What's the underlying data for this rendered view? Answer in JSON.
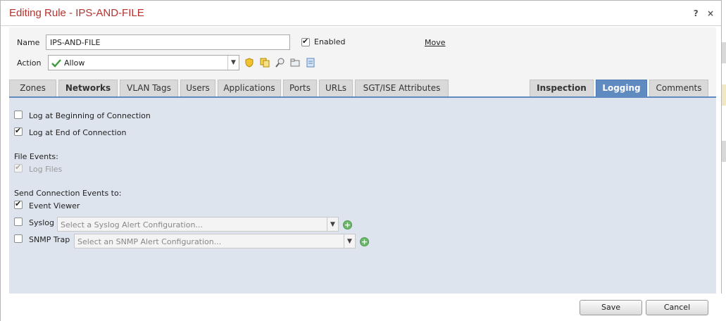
{
  "dialog": {
    "title": "Editing Rule - IPS-AND-FILE",
    "help_icon": "?",
    "close_icon": "×"
  },
  "rule": {
    "name_label": "Name",
    "name_value": "IPS-AND-FILE",
    "enabled_label": "Enabled",
    "enabled_checked": true,
    "move_label": "Move",
    "action_label": "Action",
    "action_value": "Allow",
    "action_icons": [
      "shield-icon",
      "copy-icon",
      "search-icon",
      "folder-icon",
      "note-icon"
    ]
  },
  "tabs": {
    "left": [
      {
        "label": "Zones"
      },
      {
        "label": "Networks"
      },
      {
        "label": "VLAN Tags"
      },
      {
        "label": "Users"
      },
      {
        "label": "Applications"
      },
      {
        "label": "Ports"
      },
      {
        "label": "URLs"
      },
      {
        "label": "SGT/ISE Attributes"
      }
    ],
    "right": [
      {
        "label": "Inspection"
      },
      {
        "label": "Logging"
      },
      {
        "label": "Comments"
      }
    ],
    "active": "Logging"
  },
  "logging": {
    "log_begin": {
      "label": "Log at Beginning of Connection",
      "checked": false
    },
    "log_end": {
      "label": "Log at End of Connection",
      "checked": true
    },
    "file_events_heading": "File Events:",
    "log_files": {
      "label": "Log Files",
      "checked": true,
      "disabled": true
    },
    "send_heading": "Send Connection Events to:",
    "event_viewer": {
      "label": "Event Viewer",
      "checked": true
    },
    "syslog": {
      "label": "Syslog",
      "checked": false,
      "placeholder": "Select a Syslog Alert Configuration..."
    },
    "snmp": {
      "label": "SNMP Trap",
      "checked": false,
      "placeholder": "Select an SNMP Alert Configuration..."
    }
  },
  "footer": {
    "save_label": "Save",
    "cancel_label": "Cancel"
  },
  "colors": {
    "title": "#b5332e",
    "active_tab": "#5f8bc1",
    "panel_bg": "#dde4ed"
  }
}
